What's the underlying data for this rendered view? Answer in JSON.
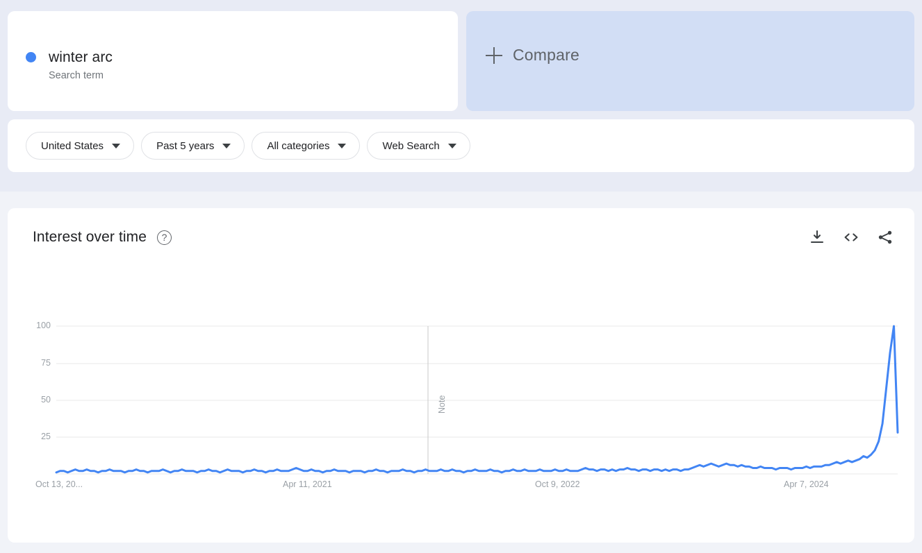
{
  "search_term": {
    "name": "winter arc",
    "type_label": "Search term",
    "dot_color": "#4285f4"
  },
  "compare": {
    "label": "Compare",
    "icon": "plus-icon",
    "background": "#d2def5"
  },
  "filters": [
    {
      "label": "United States",
      "icon": "chevron-down-icon"
    },
    {
      "label": "Past 5 years",
      "icon": "chevron-down-icon"
    },
    {
      "label": "All categories",
      "icon": "chevron-down-icon"
    },
    {
      "label": "Web Search",
      "icon": "chevron-down-icon"
    }
  ],
  "chart_card": {
    "title": "Interest over time",
    "help_icon": "help-circle-icon",
    "help_glyph": "?",
    "actions": [
      {
        "name": "download-icon",
        "tooltip": "Download"
      },
      {
        "name": "embed-code-icon",
        "tooltip": "Embed"
      },
      {
        "name": "share-icon",
        "tooltip": "Share"
      }
    ]
  },
  "chart_data": {
    "type": "line",
    "title": "Interest over time",
    "xlabel": "",
    "ylabel": "",
    "ylim": [
      0,
      100
    ],
    "yticks": [
      25,
      50,
      75,
      100
    ],
    "ytick_labels": [
      "25",
      "50",
      "75",
      "100"
    ],
    "xtick_labels": [
      "Oct 13, 20...",
      "Apr 11, 2021",
      "Oct 9, 2022",
      "Apr 7, 2024"
    ],
    "xtick_positions": [
      0,
      0.2857,
      0.619,
      0.9048
    ],
    "grid": true,
    "legend_position": "top-card",
    "line_color": "#4285f4",
    "series": [
      {
        "name": "winter arc",
        "values": [
          1,
          2,
          2,
          1,
          2,
          3,
          2,
          2,
          3,
          2,
          2,
          1,
          2,
          2,
          3,
          2,
          2,
          2,
          1,
          2,
          2,
          3,
          2,
          2,
          1,
          2,
          2,
          2,
          3,
          2,
          1,
          2,
          2,
          3,
          2,
          2,
          2,
          1,
          2,
          2,
          3,
          2,
          2,
          1,
          2,
          3,
          2,
          2,
          2,
          1,
          2,
          2,
          3,
          2,
          2,
          1,
          2,
          2,
          3,
          2,
          2,
          2,
          3,
          4,
          3,
          2,
          2,
          3,
          2,
          2,
          1,
          2,
          2,
          3,
          2,
          2,
          2,
          1,
          2,
          2,
          2,
          1,
          2,
          2,
          3,
          2,
          2,
          1,
          2,
          2,
          2,
          3,
          2,
          2,
          1,
          2,
          2,
          3,
          2,
          2,
          2,
          3,
          2,
          2,
          3,
          2,
          2,
          1,
          2,
          2,
          3,
          2,
          2,
          2,
          3,
          2,
          2,
          1,
          2,
          2,
          3,
          2,
          2,
          3,
          2,
          2,
          2,
          3,
          2,
          2,
          2,
          3,
          2,
          2,
          3,
          2,
          2,
          2,
          3,
          4,
          3,
          3,
          2,
          3,
          3,
          2,
          3,
          2,
          3,
          3,
          4,
          3,
          3,
          2,
          3,
          3,
          2,
          3,
          3,
          2,
          3,
          2,
          3,
          3,
          2,
          3,
          3,
          4,
          5,
          6,
          5,
          6,
          7,
          6,
          5,
          6,
          7,
          6,
          6,
          5,
          6,
          5,
          5,
          4,
          4,
          5,
          4,
          4,
          4,
          3,
          4,
          4,
          4,
          3,
          4,
          4,
          4,
          5,
          4,
          5,
          5,
          5,
          6,
          6,
          7,
          8,
          7,
          8,
          9,
          8,
          9,
          10,
          12,
          11,
          13,
          16,
          22,
          34,
          58,
          82,
          100,
          28
        ],
        "annotations": [
          {
            "label": "Note",
            "x_fraction": 0.5238,
            "type": "vertical-line"
          }
        ]
      }
    ],
    "peak": {
      "value": 100,
      "label": "100"
    },
    "last_value": 28
  }
}
